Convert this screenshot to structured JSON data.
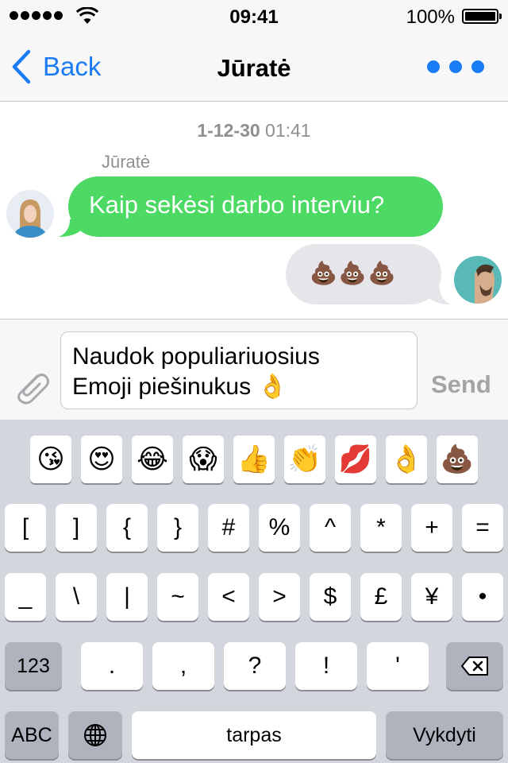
{
  "status_bar": {
    "time": "09:41",
    "battery": "100%"
  },
  "nav": {
    "back_label": "Back",
    "title": "Jūratė"
  },
  "messages": {
    "timestamp_date": "1-12-30",
    "timestamp_time": "01:41",
    "sender_name": "Jūratė",
    "incoming_text": "Kaip sekėsi darbo interviu?",
    "outgoing_text": "💩💩💩"
  },
  "composer": {
    "input_text": "Naudok populiariuosius\nEmoji piešinukus 👌",
    "send_label": "Send"
  },
  "keyboard": {
    "emoji_row": [
      "😘",
      "😍",
      "😂",
      "😱",
      "👍",
      "👏",
      "💋",
      "👌",
      "💩"
    ],
    "row1": [
      "[",
      "]",
      "{",
      "}",
      "#",
      "%",
      "^",
      "*",
      "+",
      "="
    ],
    "row2": [
      "_",
      "\\",
      "|",
      "~",
      "<",
      ">",
      "$",
      "£",
      "¥",
      "•"
    ],
    "row3": [
      ".",
      ",",
      "?",
      "!",
      "'"
    ],
    "numbers_label": "123",
    "abc_label": "ABC",
    "space_label": "tarpas",
    "return_label": "Vykdyti"
  },
  "colors": {
    "accent": "#1a7cf5",
    "incoming_bubble": "#4cd964",
    "outgoing_bubble": "#e5e5ea"
  }
}
